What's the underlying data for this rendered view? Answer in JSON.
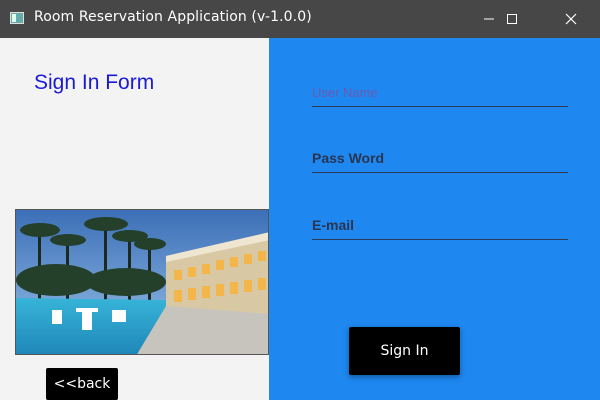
{
  "window": {
    "title": "Room Reservation Application (v-1.0.0)",
    "controls": [
      "minimize-icon",
      "maximize-icon",
      "close-icon"
    ]
  },
  "left_panel": {
    "heading": "Sign In Form",
    "heading_color": "#1a1ad4",
    "image": "hotel-pool-resort-photo",
    "back_label": "<<back"
  },
  "form": {
    "background": "#1e87f0",
    "username_placeholder": "User Name",
    "password_placeholder": "Pass Word",
    "email_placeholder": "E-mail",
    "submit_label": "Sign In"
  }
}
